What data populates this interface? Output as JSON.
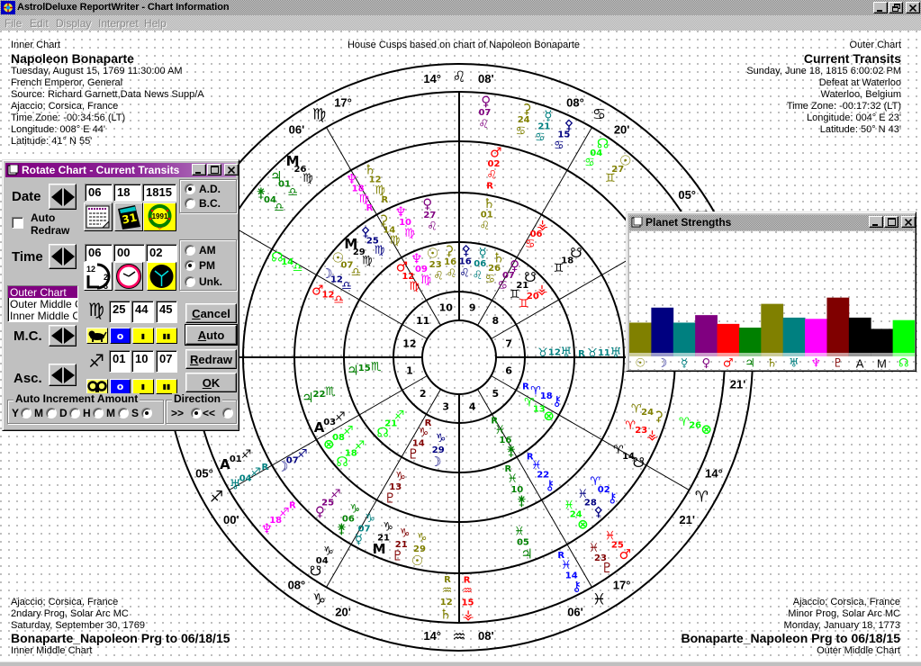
{
  "window": {
    "title": "AstrolDeluxe ReportWriter - Chart Information",
    "menu": [
      "File",
      "Edit",
      "Display",
      "Interpret",
      "Help"
    ]
  },
  "header": {
    "center_caption": "House Cusps based on chart of Napoleon Bonaparte",
    "inner_chart": {
      "caption": "Inner Chart",
      "name": "Napoleon Bonaparte",
      "lines": [
        "Tuesday, August 15, 1769 11:30:00 AM",
        "French Emperor, General",
        "Source: Richard Garnett,Data News Supp/A",
        "Ajaccio; Corsica, France",
        "Time Zone: -00:34:56 (LT)",
        "Longitude: 008° E 44'",
        "Latitude: 41° N 55'"
      ]
    },
    "outer_chart": {
      "caption": "Outer Chart",
      "name": "Current Transits",
      "lines": [
        "Sunday, June 18, 1815 6:00:02 PM",
        "Defeat at Waterloo",
        "Waterloo, Belgium",
        "Time Zone: -00:17:32 (LT)",
        "Longitude: 004° E 23'",
        "Latitude: 50° N 43'"
      ]
    }
  },
  "footer": {
    "inner_middle_chart": {
      "lines": [
        "Ajaccio; Corsica, France",
        "2ndary Prog, Solar Arc MC",
        "Saturday, September 30, 1769"
      ],
      "name": "Bonaparte_Napoleon Prg to 06/18/15",
      "caption": "Inner Middle Chart"
    },
    "outer_middle_chart": {
      "lines": [
        "Ajaccio; Corsica, France",
        "Minor Prog, Solar Arc MC",
        "Monday, January 18, 1773"
      ],
      "name": "Bonaparte_Napoleon Prg to 06/18/15",
      "caption": "Outer Middle Chart"
    }
  },
  "symbols": {
    "sign_order": [
      "aries",
      "taurus",
      "gemini",
      "cancer",
      "leo",
      "virgo",
      "libra",
      "scorpio",
      "sagittarius",
      "capricorn",
      "aquarius",
      "pisces"
    ],
    "signs": {
      "aries": "♈",
      "taurus": "♉",
      "gemini": "♊",
      "cancer": "♋",
      "leo": "♌",
      "virgo": "♍",
      "libra": "♎",
      "scorpio": "♏",
      "sagittarius": "♐",
      "capricorn": "♑",
      "aquarius": "♒",
      "pisces": "♓"
    },
    "retrograde": "R",
    "bodies": {
      "sun": {
        "glyph": "☉",
        "color": "#808000"
      },
      "moon": {
        "glyph": "☽",
        "color": "#000080"
      },
      "mercury": {
        "glyph": "☿",
        "color": "#008080"
      },
      "venus": {
        "glyph": "♀",
        "color": "#800080"
      },
      "mars": {
        "glyph": "♂",
        "color": "#ff0000"
      },
      "jupiter": {
        "glyph": "♃",
        "color": "#008000"
      },
      "saturn": {
        "glyph": "♄",
        "color": "#808000"
      },
      "uranus": {
        "glyph": "♅",
        "color": "#008080"
      },
      "neptune": {
        "glyph": "♆",
        "color": "#ff00ff"
      },
      "pluto": {
        "glyph": "♇",
        "color": "#800000"
      },
      "ceres": {
        "glyph": "⚳",
        "color": "#808000"
      },
      "pallas": {
        "glyph": "⚴",
        "color": "#000080"
      },
      "juno": {
        "glyph": "⚵",
        "color": "#008000"
      },
      "vesta": {
        "glyph": "⚶",
        "color": "#ff0000"
      },
      "chiron": {
        "glyph": "⚷",
        "color": "#0000ff"
      },
      "north_node": {
        "glyph": "☊",
        "color": "#00ff00"
      },
      "south_node": {
        "glyph": "☋",
        "color": "#000000"
      },
      "fortune": {
        "glyph": "⊗",
        "color": "#00ff00"
      },
      "asc": {
        "glyph": "A",
        "color": "#000000"
      },
      "mc": {
        "glyph": "M",
        "color": "#000000"
      }
    }
  },
  "wheel": {
    "house_numbers": [
      "1",
      "2",
      "3",
      "4",
      "5",
      "6",
      "7",
      "8",
      "9",
      "10",
      "11",
      "12"
    ],
    "cusps": [
      {
        "house": 2,
        "deg": "05°",
        "sign": "sagittarius",
        "min": "00'"
      },
      {
        "house": 3,
        "deg": "08°",
        "sign": "capricorn",
        "min": "20'"
      },
      {
        "house": 4,
        "deg": "14°",
        "sign": "aquarius",
        "min": "08'"
      },
      {
        "house": 5,
        "deg": "17°",
        "sign": "pisces",
        "min": "06'"
      },
      {
        "house": 6,
        "deg": "14°",
        "sign": "aries",
        "min": "21'"
      },
      {
        "house": 7,
        "min": "21'"
      },
      {
        "house": 8,
        "deg": "05°",
        "sign": "gemini",
        "min": "00'"
      },
      {
        "house": 9,
        "deg": "08°",
        "sign": "cancer",
        "min": "20'"
      },
      {
        "house": 10,
        "deg": "14°",
        "sign": "leo",
        "min": "08'"
      },
      {
        "house": 11,
        "deg": "17°",
        "sign": "virgo",
        "min": "06'"
      }
    ],
    "rings": [
      {
        "id": "inner-chart",
        "chart": "Inner Chart",
        "points": [
          {
            "body": "sun",
            "deg": "23",
            "sign": "leo"
          },
          {
            "body": "ceres",
            "deg": "16",
            "sign": "leo"
          },
          {
            "body": "pallas",
            "deg": "16",
            "sign": "leo"
          },
          {
            "body": "mercury",
            "deg": "06",
            "sign": "leo"
          },
          {
            "body": "saturn",
            "deg": "26",
            "sign": "cancer"
          },
          {
            "body": "neptune",
            "deg": "09",
            "sign": "virgo"
          },
          {
            "body": "mars",
            "deg": "12",
            "sign": "virgo"
          },
          {
            "body": "venus",
            "deg": "07",
            "sign": "cancer"
          },
          {
            "body": "south_node",
            "deg": "21",
            "sign": "gemini"
          },
          {
            "body": "vesta",
            "deg": "20",
            "sign": "gemini"
          },
          {
            "body": "uranus",
            "deg": "12",
            "sign": "taurus"
          },
          {
            "body": "chiron",
            "deg": "18",
            "sign": "aries",
            "retro": true
          },
          {
            "body": "fortune",
            "deg": "13",
            "sign": "aries"
          },
          {
            "body": "juno",
            "deg": "16",
            "sign": "pisces",
            "retro": true
          },
          {
            "body": "moon",
            "deg": "29",
            "sign": "capricorn"
          },
          {
            "body": "pluto",
            "deg": "14",
            "sign": "capricorn",
            "retro": true
          },
          {
            "body": "north_node",
            "deg": "21",
            "sign": "sagittarius"
          },
          {
            "body": "jupiter",
            "deg": "15",
            "sign": "scorpio"
          }
        ]
      },
      {
        "id": "inner-middle-chart",
        "chart": "Inner Middle Chart",
        "points": [
          {
            "body": "saturn",
            "deg": "01",
            "sign": "leo"
          },
          {
            "body": "venus",
            "deg": "27",
            "sign": "leo"
          },
          {
            "body": "neptune",
            "deg": "10",
            "sign": "virgo"
          },
          {
            "body": "ceres",
            "deg": "14",
            "sign": "virgo"
          },
          {
            "body": "pallas",
            "deg": "25",
            "sign": "virgo"
          },
          {
            "body": "mc",
            "deg": "29",
            "sign": "virgo"
          },
          {
            "body": "sun",
            "deg": "07",
            "sign": "libra"
          },
          {
            "body": "mars",
            "deg": "12",
            "sign": "libra"
          },
          {
            "body": "moon",
            "deg": "12",
            "sign": "libra"
          },
          {
            "body": "jupiter",
            "deg": "22",
            "sign": "scorpio"
          },
          {
            "body": "asc",
            "deg": "03",
            "sign": "sagittarius"
          },
          {
            "body": "fortune",
            "deg": "08",
            "sign": "sagittarius"
          },
          {
            "body": "north_node",
            "deg": "18",
            "sign": "sagittarius"
          },
          {
            "body": "pluto",
            "deg": "13",
            "sign": "capricorn"
          },
          {
            "body": "juno",
            "deg": "10",
            "sign": "pisces",
            "retro": true
          },
          {
            "body": "chiron",
            "deg": "22",
            "sign": "pisces",
            "retro": true
          },
          {
            "body": "uranus",
            "deg": "11",
            "sign": "taurus",
            "retro": true
          },
          {
            "body": "south_node",
            "deg": "18",
            "sign": "gemini"
          },
          {
            "body": "vesta",
            "deg": "06",
            "sign": "cancer"
          }
        ]
      },
      {
        "id": "outer-middle-chart",
        "chart": "Outer Middle Chart",
        "points": [
          {
            "body": "mars",
            "deg": "02",
            "sign": "leo",
            "retro": true
          },
          {
            "body": "saturn",
            "deg": "12",
            "sign": "virgo",
            "retro": true
          },
          {
            "body": "neptune",
            "deg": "18",
            "sign": "virgo",
            "retro": true
          },
          {
            "body": "north_node",
            "deg": "14",
            "sign": "libra"
          },
          {
            "body": "moon",
            "deg": "07",
            "sign": "sagittarius"
          },
          {
            "body": "venus",
            "deg": "25",
            "sign": "sagittarius"
          },
          {
            "body": "juno",
            "deg": "06",
            "sign": "capricorn"
          },
          {
            "body": "mercury",
            "deg": "07",
            "sign": "capricorn"
          },
          {
            "body": "mc",
            "deg": "21",
            "sign": "capricorn"
          },
          {
            "body": "pluto",
            "deg": "21",
            "sign": "capricorn"
          },
          {
            "body": "sun",
            "deg": "29",
            "sign": "capricorn"
          },
          {
            "body": "jupiter",
            "deg": "05",
            "sign": "pisces"
          },
          {
            "body": "fortune",
            "deg": "24",
            "sign": "pisces"
          },
          {
            "body": "pallas",
            "deg": "28",
            "sign": "pisces"
          },
          {
            "body": "chiron",
            "deg": "02",
            "sign": "aries"
          },
          {
            "body": "south_node",
            "deg": "14",
            "sign": "aries"
          },
          {
            "body": "vesta",
            "deg": "23",
            "sign": "aries"
          },
          {
            "body": "ceres",
            "deg": "24",
            "sign": "aries"
          }
        ]
      },
      {
        "id": "outer-chart",
        "chart": "Outer Chart",
        "points": [
          {
            "body": "mc",
            "deg": "26",
            "sign": "virgo"
          },
          {
            "body": "jupiter",
            "deg": "01",
            "sign": "libra"
          },
          {
            "body": "juno",
            "deg": "04",
            "sign": "libra"
          },
          {
            "body": "asc",
            "deg": "01",
            "sign": "sagittarius"
          },
          {
            "body": "uranus",
            "deg": "04",
            "sign": "sagittarius",
            "retro": true
          },
          {
            "body": "neptune",
            "deg": "18",
            "sign": "sagittarius",
            "retro": true
          },
          {
            "body": "south_node",
            "deg": "04",
            "sign": "capricorn"
          },
          {
            "body": "saturn",
            "deg": "12",
            "sign": "aquarius",
            "retro": true
          },
          {
            "body": "vesta",
            "deg": "15",
            "sign": "aquarius",
            "retro": true
          },
          {
            "body": "chiron",
            "deg": "14",
            "sign": "pisces",
            "retro": true
          },
          {
            "body": "pluto",
            "deg": "23",
            "sign": "pisces"
          },
          {
            "body": "mars",
            "deg": "25",
            "sign": "pisces"
          },
          {
            "body": "fortune",
            "deg": "26",
            "sign": "aries"
          },
          {
            "body": "sun",
            "deg": "27",
            "sign": "gemini"
          },
          {
            "body": "north_node",
            "deg": "04",
            "sign": "cancer"
          },
          {
            "body": "pallas",
            "deg": "15",
            "sign": "cancer"
          },
          {
            "body": "mercury",
            "deg": "21",
            "sign": "cancer"
          },
          {
            "body": "ceres",
            "deg": "24",
            "sign": "cancer"
          },
          {
            "body": "venus",
            "deg": "07",
            "sign": "leo"
          }
        ]
      }
    ]
  },
  "rotate_dialog": {
    "title": "Rotate Chart - Current Transits",
    "date": {
      "label": "Date",
      "month": "06",
      "day": "18",
      "year": "1815",
      "era_options": [
        {
          "label": "A.D.",
          "checked": true
        },
        {
          "label": "B.C.",
          "checked": false
        }
      ],
      "icon_texts": {
        "day_calendar": "31",
        "year_wreath": "1991"
      }
    },
    "auto_redraw": {
      "line1": "Auto",
      "line2": "Redraw",
      "checked": false
    },
    "time": {
      "label": "Time",
      "hour": "06",
      "minute": "00",
      "second": "02",
      "options": [
        {
          "label": "AM",
          "checked": false
        },
        {
          "label": "PM",
          "checked": true
        },
        {
          "label": "Unk.",
          "checked": false
        }
      ],
      "clock_numbers": [
        "12",
        "2",
        "3"
      ]
    },
    "chart_list": {
      "items": [
        "Outer Chart",
        "Outer Middle Ch",
        "Inner Middle Ch"
      ],
      "selected": 0
    },
    "mc": {
      "label": "M.C.",
      "sign": "♍",
      "deg": "25",
      "min": "44",
      "sec": "45"
    },
    "asc": {
      "label": "Asc.",
      "sign": "♐",
      "deg": "01",
      "min": "10",
      "sec": "07"
    },
    "step_buttons": [
      "o",
      "▮",
      "▮▮"
    ],
    "buttons": {
      "cancel": "Cancel",
      "auto": "Auto",
      "redraw": "Redraw",
      "ok": "OK"
    },
    "auto_increment": {
      "label": "Auto Increment Amount",
      "options": [
        {
          "label": "Y"
        },
        {
          "label": "M"
        },
        {
          "label": "D"
        },
        {
          "label": "H"
        },
        {
          "label": "M"
        },
        {
          "label": "S",
          "checked": true
        }
      ]
    },
    "direction": {
      "label": "Direction",
      "options": [
        {
          "label": ">>",
          "checked": true
        },
        {
          "label": "<<",
          "checked": false
        }
      ]
    }
  },
  "chart_data": {
    "type": "bar",
    "title": "Planet Strengths",
    "categories": [
      "☉",
      "☽",
      "☿",
      "♀",
      "♂",
      "♃",
      "♄",
      "♅",
      "♆",
      "♇",
      "A",
      "M",
      "☊"
    ],
    "category_bodies": [
      "sun",
      "moon",
      "mercury",
      "venus",
      "mars",
      "jupiter",
      "saturn",
      "uranus",
      "neptune",
      "pluto",
      "asc",
      "mc",
      "north_node"
    ],
    "values": [
      27,
      39,
      27,
      33,
      26,
      23,
      42,
      31,
      30,
      47,
      31,
      22,
      29
    ],
    "ylim": [
      0,
      100
    ],
    "xlabel": "",
    "ylabel": "",
    "grid": false,
    "legend": "none"
  }
}
